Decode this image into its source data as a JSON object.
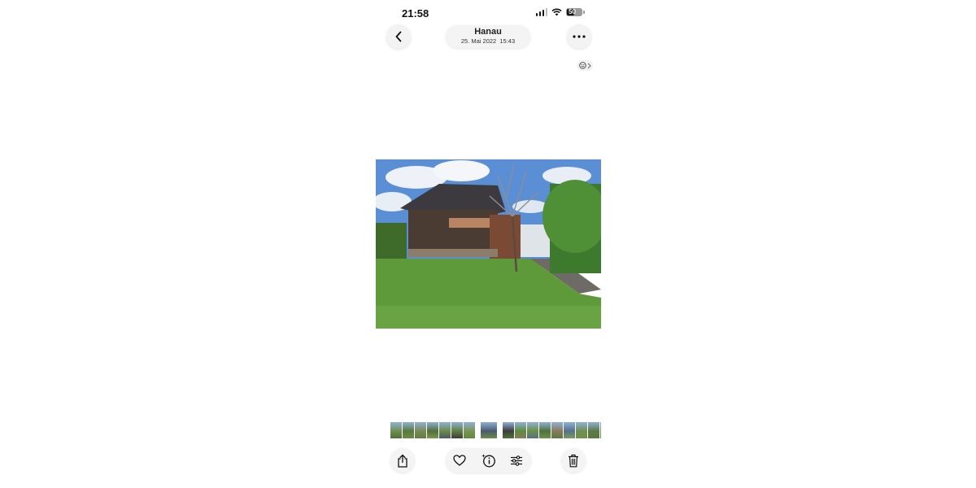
{
  "status_bar": {
    "time": "21:58",
    "battery": "50",
    "battery_level": 0.5
  },
  "header": {
    "location": "Hanau",
    "datetime": "25. Mai 2022  15:43",
    "back_icon": "chevron-left-icon",
    "more_icon": "ellipsis-icon"
  },
  "live_badge": {
    "icon": "emoji-face-icon"
  },
  "photo": {
    "description_icon": "photo"
  },
  "filmstrip": {
    "count": 17,
    "selected_index": 7
  },
  "toolbar": {
    "share_icon": "share-icon",
    "favorite_icon": "heart-icon",
    "info_icon": "info-sparkle-icon",
    "adjust_icon": "sliders-icon",
    "delete_icon": "trash-icon"
  },
  "colors": {
    "accent": "#111111",
    "sky": "#5a8fd6",
    "grass": "#5f9a3a"
  }
}
